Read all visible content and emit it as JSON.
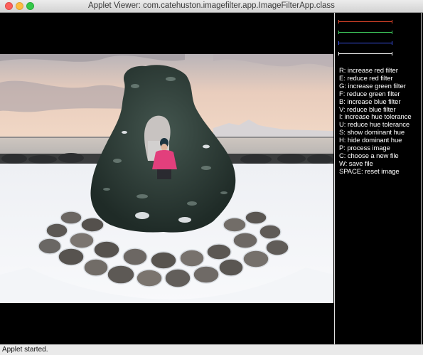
{
  "window": {
    "title": "Applet Viewer: com.catehuston.imagefilter.app.ImageFilterApp.class"
  },
  "controls": {
    "sliders": [
      {
        "filter": "red",
        "color": "#e0442a"
      },
      {
        "filter": "green",
        "color": "#3cc45a"
      },
      {
        "filter": "blue",
        "color": "#3a4fe0"
      },
      {
        "filter": "hue",
        "color": "#ffffff"
      }
    ],
    "instructions": [
      "R: increase red filter",
      "E: reduce red filter",
      "G: increase green filter",
      "F: reduce green filter",
      "B: increase blue filter",
      "V: reduce blue filter",
      "I: increase hue tolerance",
      "U: reduce hue tolerance",
      "S: show dominant hue",
      "H: hide dominant hue",
      "P: process image",
      "C: choose a new file",
      "W: save file",
      "SPACE: reset image"
    ]
  },
  "status": {
    "text": "Applet started."
  }
}
